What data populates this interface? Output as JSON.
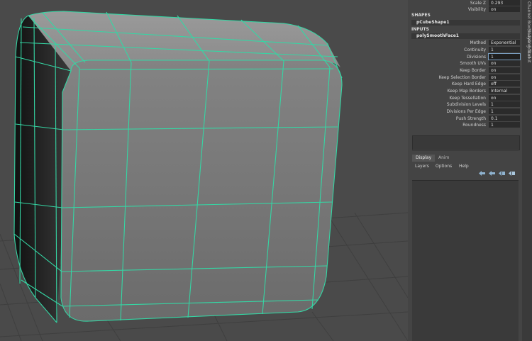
{
  "channel_box": {
    "top_rows": [
      {
        "label": "Scale Z",
        "value": "0.293"
      },
      {
        "label": "Visibility",
        "value": "on"
      }
    ],
    "shapes_header": "SHAPES",
    "shape_node": "pCubeShape1",
    "inputs_header": "INPUTS",
    "input_node": "polySmoothFace1",
    "attributes": [
      {
        "label": "Method",
        "value": "Exponential"
      },
      {
        "label": "Continuity",
        "value": "1"
      },
      {
        "label": "Divisions",
        "value": "1"
      },
      {
        "label": "Smooth UVs",
        "value": "on"
      },
      {
        "label": "Keep Border",
        "value": "on"
      },
      {
        "label": "Keep Selection Border",
        "value": "on"
      },
      {
        "label": "Keep Hard Edge",
        "value": "off"
      },
      {
        "label": "Keep Map Borders",
        "value": "Internal"
      },
      {
        "label": "Keep Tessellation",
        "value": "on"
      },
      {
        "label": "Subdivision Levels",
        "value": "1"
      },
      {
        "label": "Divisions Per Edge",
        "value": "1"
      },
      {
        "label": "Push Strength",
        "value": "0.1"
      },
      {
        "label": "Roundness",
        "value": "1"
      }
    ]
  },
  "layer_editor": {
    "tabs": [
      "Display",
      "Anim"
    ],
    "menu": [
      "Layers",
      "Options",
      "Help"
    ]
  },
  "side_tabs": [
    "Channel Box / Layer Editor",
    "Modeling Toolkit"
  ],
  "colors": {
    "wireframe": "#35d6a4",
    "viewport_bg": "#4a4a4a",
    "panel_bg": "#444444"
  }
}
